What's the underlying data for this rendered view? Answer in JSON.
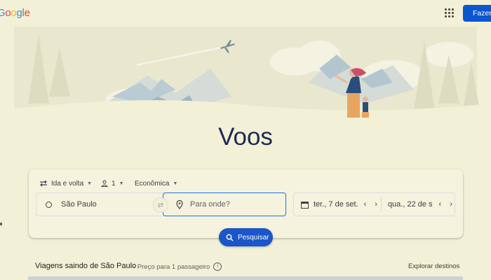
{
  "header": {
    "logo_letters": [
      "o",
      "o",
      "g",
      "l",
      "e"
    ],
    "logo_prefix": "G",
    "login_label": "Fazer"
  },
  "main": {
    "title": "Voos"
  },
  "search": {
    "trip_type": "Ida e volta",
    "passengers": "1",
    "cabin_class": "Econômica",
    "origin": "São Paulo",
    "destination_placeholder": "Para onde?",
    "depart_date": "ter., 7 de set.",
    "return_date": "qua., 22 de s",
    "search_label": "Pesquisar"
  },
  "section": {
    "title": "Viagens saindo de São Paulo",
    "subtitle": "· Preço para 1 passageiro",
    "info_glyph": "i",
    "explore_label": "Explorar destinos"
  },
  "colors": {
    "background": "#f2f0d6",
    "accent": "#1a56c8",
    "title": "#1f2a52"
  },
  "icons": [
    "apps-grid-icon",
    "round-trip-icon",
    "person-icon",
    "swap-icon",
    "location-pin-icon",
    "calendar-icon",
    "search-icon",
    "info-icon"
  ]
}
